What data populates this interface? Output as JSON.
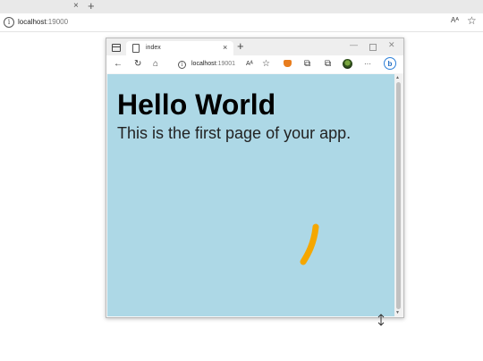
{
  "outer_browser": {
    "tab_close": "×",
    "new_tab": "+",
    "url_host": "localhost",
    "url_port": ":19000",
    "read_aloud": "Aᴬ",
    "favorite": "☆"
  },
  "window": {
    "tab_title": "index",
    "tab_close": "×",
    "new_tab": "+",
    "minimize": "—",
    "close": "✕",
    "toolbar": {
      "back": "←",
      "refresh": "↻",
      "home": "⌂",
      "url_host": "localhost",
      "url_port": ":19001",
      "read_aloud": "Aᴬ",
      "favorite": "☆",
      "extensions": "⧉",
      "collections": "⧉",
      "more": "···",
      "bing": "b"
    }
  },
  "page": {
    "heading": "Hello World",
    "subtext": "This is the first page of your app.",
    "stroke_color": "#f5a700",
    "background_color": "#add8e6"
  }
}
